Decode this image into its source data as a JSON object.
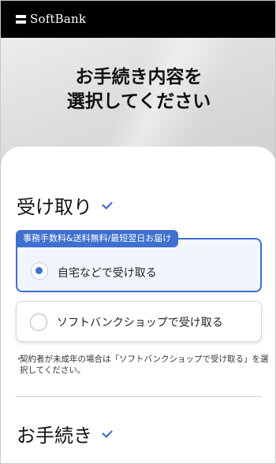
{
  "header": {
    "logo_text": "SoftBank"
  },
  "hero": {
    "title": "お手続き内容を\n選択してください"
  },
  "receive_section": {
    "title": "受け取り",
    "badge": "事務手数料&送料無料/最短翌日お届け",
    "options": [
      {
        "label": "自宅などで受け取る",
        "selected": true
      },
      {
        "label": "ソフトバンクショップで受け取る",
        "selected": false
      }
    ],
    "note": "契約者が未成年の場合は「ソフトバンクショップで受け取る」を選択してください。",
    "note_bullet": "・"
  },
  "procedure_section": {
    "title": "お手続き"
  },
  "colors": {
    "accent": "#3f6fcf",
    "header_bg": "#000000"
  }
}
